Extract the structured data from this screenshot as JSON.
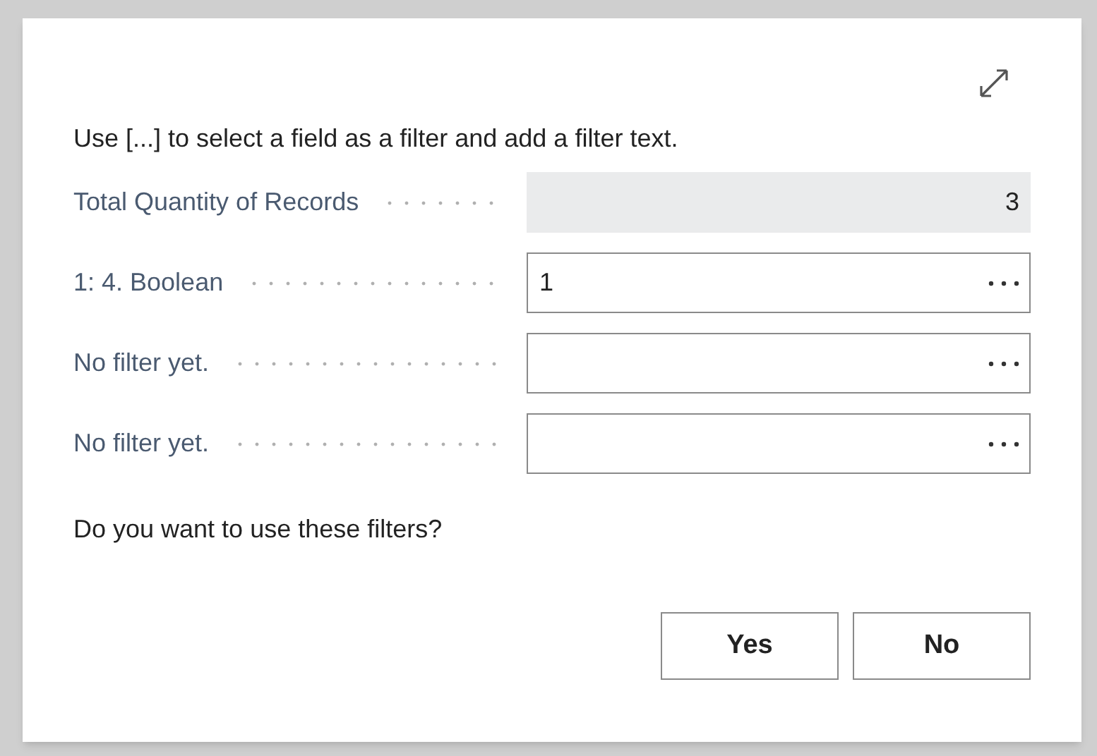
{
  "dialog": {
    "instruction": "Use [...] to select a field as a filter and add a filter text.",
    "fields": [
      {
        "kind": "readonly",
        "label": "Total Quantity of Records",
        "value": "3"
      },
      {
        "kind": "filter",
        "label": "1: 4. Boolean",
        "value": "1"
      },
      {
        "kind": "filter",
        "label": "No filter yet."
      },
      {
        "kind": "filter",
        "label": "No filter yet."
      }
    ],
    "question": "Do you want to use these filters?",
    "buttons": [
      "Yes",
      "No"
    ]
  }
}
